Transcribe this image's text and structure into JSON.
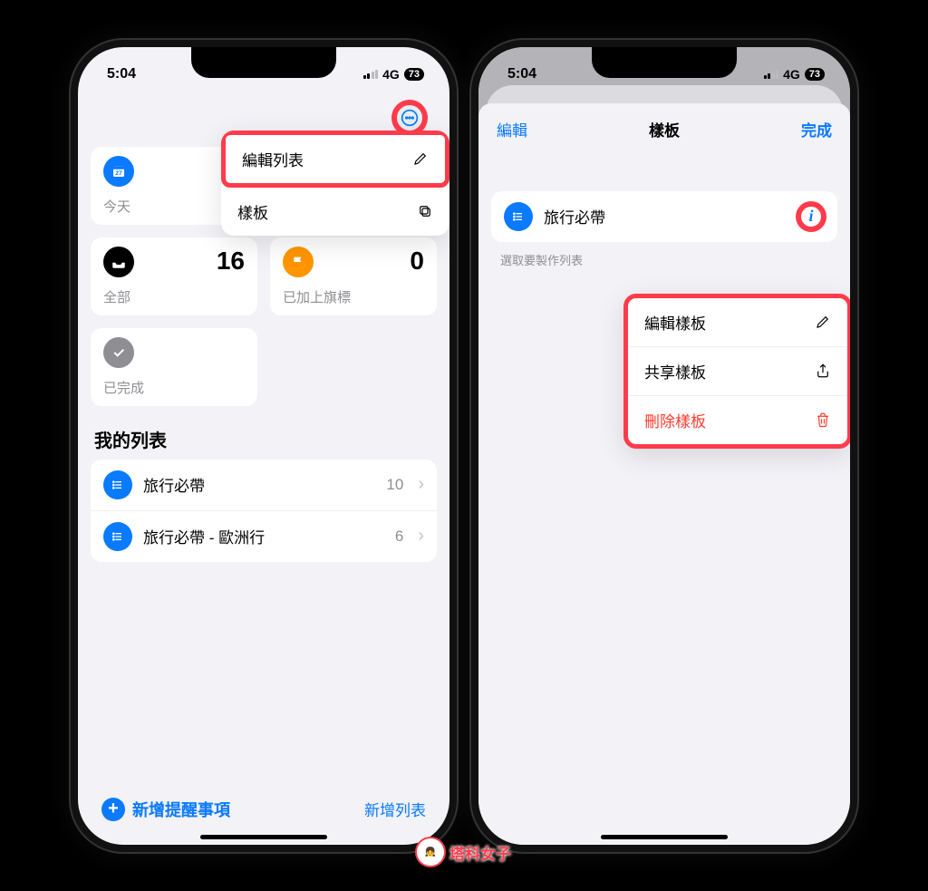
{
  "status": {
    "time": "5:04",
    "network": "4G",
    "battery": "73"
  },
  "left": {
    "menu": {
      "edit_list_label": "編輯列表",
      "templates_label": "樣板"
    },
    "cards": {
      "today": {
        "label": "今天",
        "count": ""
      },
      "all": {
        "label": "全部",
        "count": "16"
      },
      "flagged": {
        "label": "已加上旗標",
        "count": "0"
      },
      "done": {
        "label": "已完成",
        "count": ""
      }
    },
    "section_header": "我的列表",
    "lists": [
      {
        "label": "旅行必帶",
        "count": "10"
      },
      {
        "label": "旅行必帶 - 歐洲行",
        "count": "6"
      }
    ],
    "bottom": {
      "new_reminder": "新增提醒事項",
      "new_list": "新增列表"
    }
  },
  "right": {
    "header": {
      "edit": "編輯",
      "title": "樣板",
      "done": "完成"
    },
    "template": {
      "name": "旅行必帶"
    },
    "hint": "選取要製作列表",
    "menu": {
      "edit_template": "編輯樣板",
      "share_template": "共享樣板",
      "delete_template": "刪除樣板"
    }
  },
  "watermark": "塔科女子"
}
